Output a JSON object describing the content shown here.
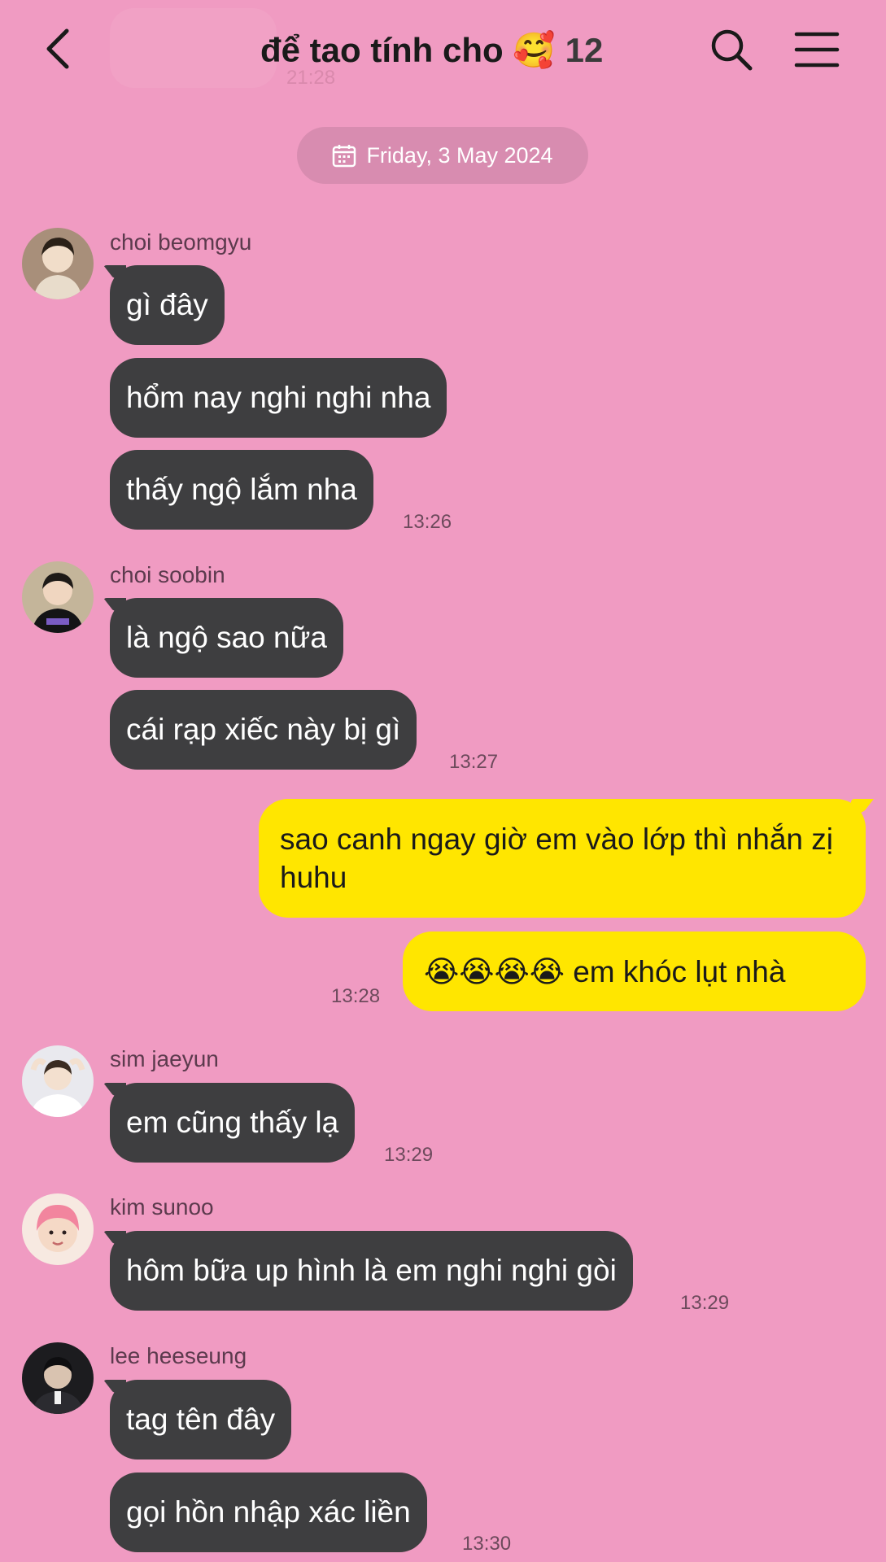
{
  "header": {
    "title": "để tao tính cho 🥰",
    "member_count": "12",
    "ghost_time": "21:28"
  },
  "date_divider": {
    "label": "Friday, 3 May 2024"
  },
  "messages": [
    {
      "sender": "choi beomgyu",
      "bubbles": [
        "gì đây",
        "hổm nay nghi nghi nha",
        "thấy ngộ lắm nha"
      ],
      "time": "13:26"
    },
    {
      "sender": "choi soobin",
      "bubbles": [
        "là ngộ sao nữa",
        "cái rạp xiếc này bị gì"
      ],
      "time": "13:27"
    },
    {
      "sender": "me",
      "bubbles": [
        "sao canh ngay giờ em vào lớp thì nhắn zị huhu",
        "😭😭😭😭 em khóc lụt nhà"
      ],
      "time": "13:28"
    },
    {
      "sender": "sim jaeyun",
      "bubbles": [
        "em cũng thấy lạ"
      ],
      "time": "13:29"
    },
    {
      "sender": "kim sunoo",
      "bubbles": [
        "hôm bữa up hình là em nghi nghi gòi"
      ],
      "time": "13:29"
    },
    {
      "sender": "lee heeseung",
      "bubbles": [
        "tag tên đây",
        "gọi hồn nhập xác liền"
      ],
      "time": "13:30"
    }
  ],
  "colors": {
    "background": "#f09bc2",
    "incoming_bubble": "#3e3e40",
    "outgoing_bubble": "#ffe600",
    "date_pill": "#d88cb0"
  },
  "icons": {
    "back": "chevron-left-icon",
    "search": "search-icon",
    "menu": "menu-icon",
    "calendar": "calendar-icon"
  }
}
